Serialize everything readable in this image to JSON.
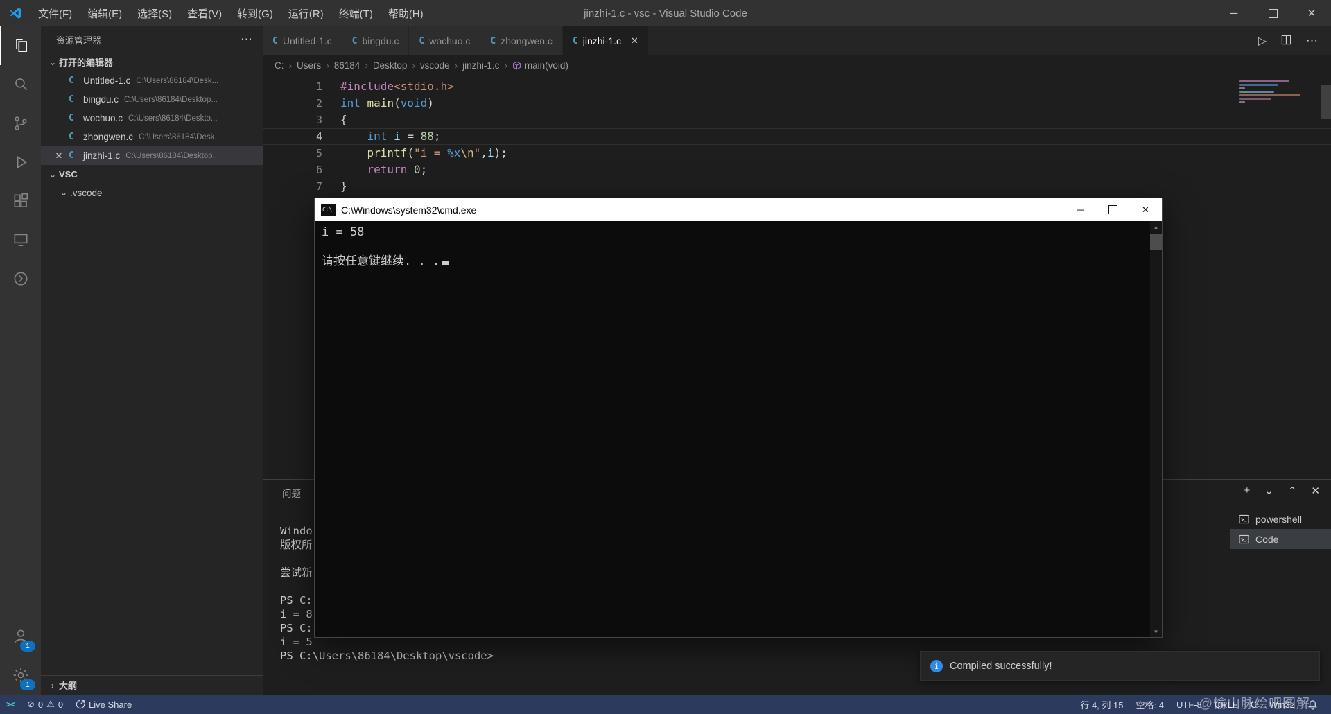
{
  "colors": {
    "accent": "#007acc",
    "status_bar_background": "#2c3a5e",
    "activity_badge": "#0e70c0",
    "c_file_icon": "#519aba",
    "info_icon": "#2d8ceb",
    "syntax": {
      "preprocessor": "#C586C0",
      "keyword": "#569CD6",
      "function": "#DCDCAA",
      "string": "#CE9178",
      "escape": "#D7BA7D",
      "number": "#B5CEA8",
      "variable": "#9CDCFE",
      "plain": "#D4D4D4"
    }
  },
  "icons": {
    "minimize": "─",
    "close": "✕",
    "ellipsis": "⋯",
    "plus": "+",
    "chevron_down": "⌄",
    "chevron_up": "⌃",
    "chevron_right": "›",
    "section_expanded": "⌄",
    "section_collapsed": "›",
    "arrow_up": "▲",
    "arrow_down": "▼",
    "run": "▷",
    "error": "⊘",
    "warning": "⚠",
    "remote": "><",
    "c_file": "C"
  },
  "title_bar": {
    "menus": [
      "文件(F)",
      "编辑(E)",
      "选择(S)",
      "查看(V)",
      "转到(G)",
      "运行(R)",
      "终端(T)",
      "帮助(H)"
    ],
    "window_title": "jinzhi-1.c - vsc - Visual Studio Code"
  },
  "activity_bar": {
    "account_badge": "1",
    "settings_badge": "1"
  },
  "sidebar": {
    "title": "资源管理器",
    "open_editors_label": "打开的编辑器",
    "folder_label": "VSC",
    "outline_label": "大纲",
    "open_editors": [
      {
        "name": "Untitled-1.c",
        "path": "C:\\Users\\86184\\Desk..."
      },
      {
        "name": "bingdu.c",
        "path": "C:\\Users\\86184\\Desktop..."
      },
      {
        "name": "wochuo.c",
        "path": "C:\\Users\\86184\\Deskto..."
      },
      {
        "name": "zhongwen.c",
        "path": "C:\\Users\\86184\\Desk..."
      },
      {
        "name": "jinzhi-1.c",
        "path": "C:\\Users\\86184\\Desktop..."
      }
    ],
    "folder_items": [
      {
        "name": ".vscode"
      }
    ]
  },
  "tabs": [
    {
      "label": "Untitled-1.c"
    },
    {
      "label": "bingdu.c"
    },
    {
      "label": "wochuo.c"
    },
    {
      "label": "zhongwen.c"
    },
    {
      "label": "jinzhi-1.c"
    }
  ],
  "breadcrumb": {
    "items": [
      "C:",
      "Users",
      "86184",
      "Desktop",
      "vscode",
      "jinzhi-1.c"
    ],
    "symbol": "main(void)"
  },
  "editor": {
    "lines": [
      {
        "num": "1",
        "tokens": [
          "#include",
          "<stdio.h>"
        ]
      },
      {
        "num": "2",
        "tokens": [
          "int",
          " ",
          "main",
          "(",
          "void",
          ")"
        ]
      },
      {
        "num": "3",
        "tokens": [
          "{"
        ]
      },
      {
        "num": "4",
        "tokens": [
          "    ",
          "int",
          " ",
          "i",
          " = ",
          "88",
          ";"
        ]
      },
      {
        "num": "5",
        "tokens": [
          "    ",
          "printf",
          "(",
          "\"i = ",
          "%x",
          "\\n",
          "\"",
          ",",
          "i",
          ");"
        ]
      },
      {
        "num": "6",
        "tokens": [
          "    ",
          "return",
          " ",
          "0",
          ";"
        ]
      },
      {
        "num": "7",
        "tokens": [
          "}"
        ]
      }
    ]
  },
  "cmd_window": {
    "title": "C:\\Windows\\system32\\cmd.exe",
    "lines": [
      "i = 58",
      "",
      "请按任意键继续. . ."
    ]
  },
  "panel": {
    "problems_tab": "问题",
    "terminal_lines": [
      "Windo",
      "版权所",
      "",
      "尝试新",
      "",
      "PS C:",
      "i = 8",
      "PS C:",
      "i = 5",
      "PS C:\\Users\\86184\\Desktop\\vscode>"
    ],
    "terminal_list": [
      {
        "label": "powershell"
      },
      {
        "label": "Code"
      }
    ]
  },
  "notification": {
    "text": "Compiled successfully!"
  },
  "status_bar": {
    "errors": "0",
    "warnings": "0",
    "live_share": "Live Share",
    "cursor_position": "行 4, 列 15",
    "indent": "空格: 4",
    "encoding": "UTF-8",
    "eol": "CRLF",
    "language": "C",
    "platform": "Win32"
  },
  "watermark": "@愉山脉绘吧图解"
}
